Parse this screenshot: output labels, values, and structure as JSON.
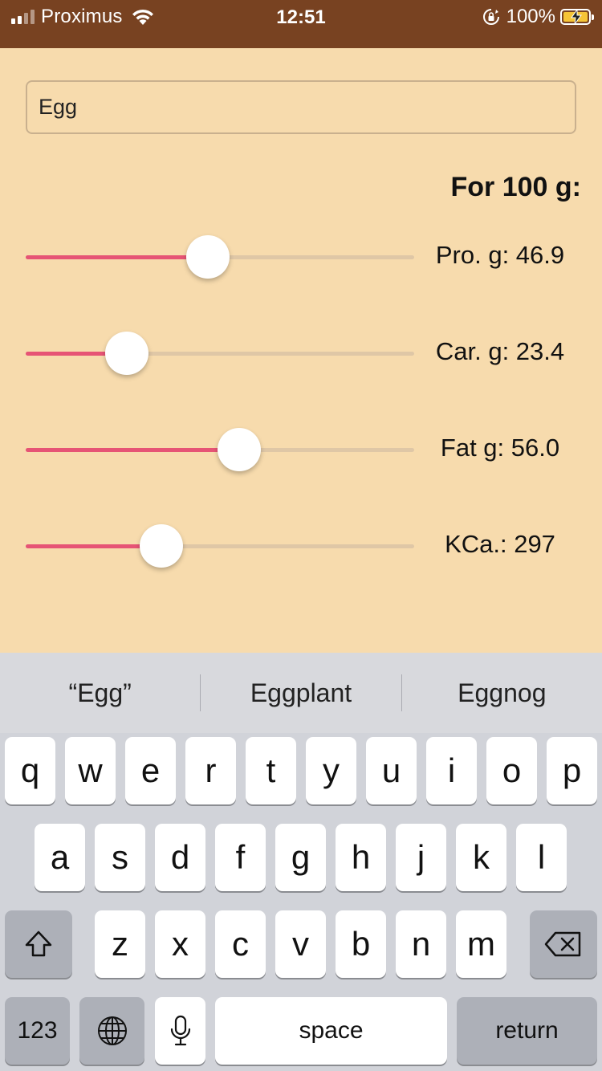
{
  "status_bar": {
    "carrier": "Proximus",
    "time": "12:51",
    "battery_percent": "100%"
  },
  "search": {
    "value": "Egg"
  },
  "for_label": "For 100 g:",
  "sliders": [
    {
      "label": "Pro. g: 46.9",
      "fraction": 0.47
    },
    {
      "label": "Car. g: 23.4",
      "fraction": 0.26
    },
    {
      "label": "Fat g: 56.0",
      "fraction": 0.55
    },
    {
      "label": "KCa.: 297",
      "fraction": 0.35
    }
  ],
  "keyboard": {
    "suggestions": [
      "“Egg”",
      "Eggplant",
      "Eggnog"
    ],
    "row1": [
      "q",
      "w",
      "e",
      "r",
      "t",
      "y",
      "u",
      "i",
      "o",
      "p"
    ],
    "row2": [
      "a",
      "s",
      "d",
      "f",
      "g",
      "h",
      "j",
      "k",
      "l"
    ],
    "row3": [
      "z",
      "x",
      "c",
      "v",
      "b",
      "n",
      "m"
    ],
    "numbers_label": "123",
    "space_label": "space",
    "return_label": "return"
  },
  "colors": {
    "status_bar_bg": "#784221",
    "app_bg": "#f7dbad",
    "slider_active": "#e65475",
    "slider_track": "#dfc7a6"
  }
}
